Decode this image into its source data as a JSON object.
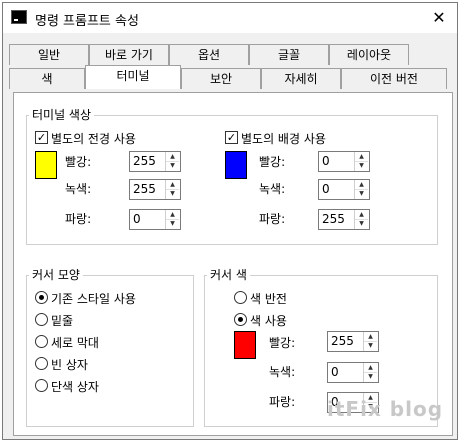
{
  "window": {
    "title": "명령 프롬프트 속성",
    "close_glyph": "✕"
  },
  "tabs": {
    "row1": [
      "일반",
      "바로 가기",
      "옵션",
      "글꼴",
      "레이아웃"
    ],
    "row2": [
      "색",
      "터미널",
      "보안",
      "자세히",
      "이전 버전"
    ],
    "active": "터미널"
  },
  "terminal_colors": {
    "label": "터미널 색상",
    "fg": {
      "check_label": "별도의 전경 사용",
      "checked": true,
      "swatch_color": "#ffff00",
      "red_label": "빨강:",
      "red": "255",
      "green_label": "녹색:",
      "green": "255",
      "blue_label": "파랑:",
      "blue": "0"
    },
    "bg": {
      "check_label": "별도의 배경 사용",
      "checked": true,
      "swatch_color": "#0000ff",
      "red_label": "빨강:",
      "red": "0",
      "green_label": "녹색:",
      "green": "0",
      "blue_label": "파랑:",
      "blue": "255"
    }
  },
  "cursor_shape": {
    "label": "커서 모양",
    "options": [
      "기존 스타일 사용",
      "밑줄",
      "세로 막대",
      "빈 상자",
      "단색 상자"
    ],
    "selected_index": 0
  },
  "cursor_color": {
    "label": "커서 색",
    "options": [
      "색 반전",
      "색 사용"
    ],
    "selected_index": 1,
    "swatch_color": "#ff0000",
    "red_label": "빨강:",
    "red": "255",
    "green_label": "녹색:",
    "green": "0",
    "blue_label": "파랑:",
    "blue": "0"
  },
  "watermark": "itFix blog",
  "check_glyph": "✓",
  "spin_up": "▲",
  "spin_down": "▼"
}
